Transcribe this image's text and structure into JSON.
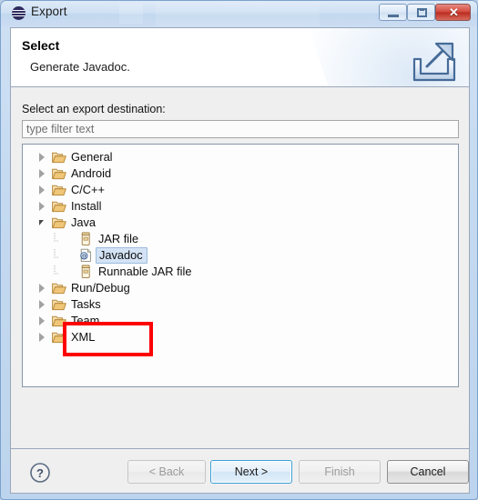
{
  "window": {
    "title": "Export",
    "icon": "eclipse-icon",
    "controls": {
      "minimize": "minimize-icon",
      "maximize": "maximize-icon",
      "close_label": "✕"
    }
  },
  "header": {
    "title": "Select",
    "subtitle": "Generate Javadoc.",
    "icon": "export-arrow-icon"
  },
  "body": {
    "destination_label": "Select an export destination:",
    "filter": {
      "value": "",
      "placeholder": "type filter text"
    },
    "tree": [
      {
        "label": "General",
        "type": "folder",
        "state": "collapsed",
        "depth": 0,
        "selected": false
      },
      {
        "label": "Android",
        "type": "folder",
        "state": "collapsed",
        "depth": 0,
        "selected": false
      },
      {
        "label": "C/C++",
        "type": "folder",
        "state": "collapsed",
        "depth": 0,
        "selected": false
      },
      {
        "label": "Install",
        "type": "folder",
        "state": "collapsed",
        "depth": 0,
        "selected": false
      },
      {
        "label": "Java",
        "type": "folder",
        "state": "expanded",
        "depth": 0,
        "selected": false
      },
      {
        "label": "JAR file",
        "type": "jar",
        "state": "leaf",
        "depth": 1,
        "selected": false
      },
      {
        "label": "Javadoc",
        "type": "javadoc",
        "state": "leaf",
        "depth": 1,
        "selected": true
      },
      {
        "label": "Runnable JAR file",
        "type": "jar",
        "state": "leaf",
        "depth": 1,
        "selected": false
      },
      {
        "label": "Run/Debug",
        "type": "folder",
        "state": "collapsed",
        "depth": 0,
        "selected": false
      },
      {
        "label": "Tasks",
        "type": "folder",
        "state": "collapsed",
        "depth": 0,
        "selected": false
      },
      {
        "label": "Team",
        "type": "folder",
        "state": "collapsed",
        "depth": 0,
        "selected": false
      },
      {
        "label": "XML",
        "type": "folder",
        "state": "collapsed",
        "depth": 0,
        "selected": false
      }
    ],
    "annotation": {
      "type": "rectangle-highlight",
      "color": "#fe0000",
      "target": "Javadoc"
    }
  },
  "footer": {
    "help_icon": "question-mark-icon",
    "buttons": {
      "back": {
        "label": "< Back",
        "enabled": false,
        "default": false
      },
      "next": {
        "label": "Next >",
        "enabled": true,
        "default": true
      },
      "finish": {
        "label": "Finish",
        "enabled": false,
        "default": false
      },
      "cancel": {
        "label": "Cancel",
        "enabled": true,
        "default": false
      }
    }
  },
  "colors": {
    "annotation": "#fe0000",
    "selection": "#d3e3f5",
    "accent": "#3d9fd6",
    "folder": "#e8b96a"
  }
}
